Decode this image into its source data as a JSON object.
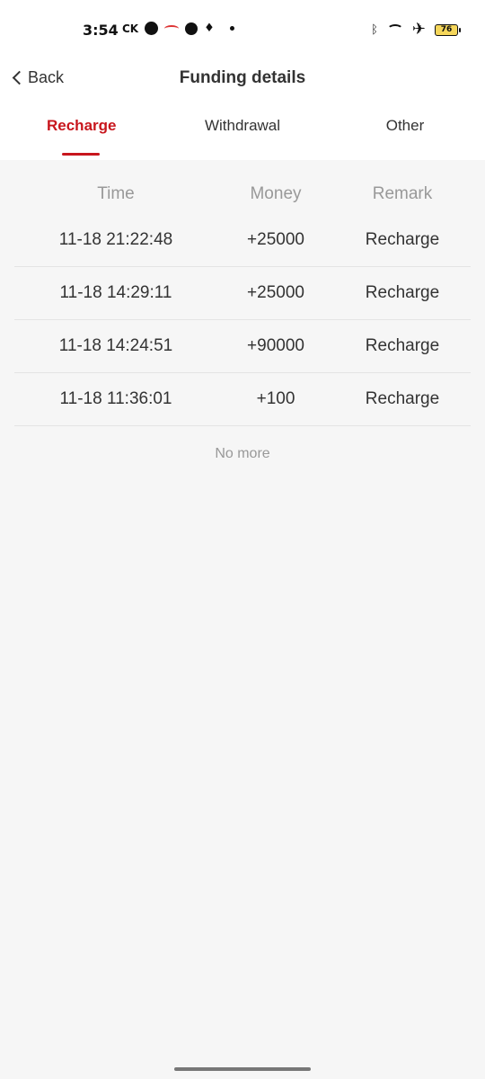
{
  "status": {
    "time": "3:54",
    "carrier_label": "CK",
    "battery": "76",
    "icons": [
      "call-icon",
      "notification-icon",
      "jio-icon",
      "bell-icon",
      "bluetooth-icon",
      "wifi-icon",
      "airplane-icon",
      "battery-icon"
    ]
  },
  "nav": {
    "back_label": "Back",
    "title": "Funding details"
  },
  "tabs": [
    {
      "label": "Recharge",
      "active": true
    },
    {
      "label": "Withdrawal",
      "active": false
    },
    {
      "label": "Other",
      "active": false
    }
  ],
  "table": {
    "headers": [
      "Time",
      "Money",
      "Remark"
    ],
    "rows": [
      {
        "time": "11-18 21:22:48",
        "money": "+25000",
        "remark": "Recharge"
      },
      {
        "time": "11-18 14:29:11",
        "money": "+25000",
        "remark": "Recharge"
      },
      {
        "time": "11-18 14:24:51",
        "money": "+90000",
        "remark": "Recharge"
      },
      {
        "time": "11-18 11:36:01",
        "money": "+100",
        "remark": "Recharge"
      }
    ]
  },
  "footer": {
    "no_more": "No more"
  },
  "colors": {
    "accent": "#c8161d",
    "background": "#f6f6f6",
    "text": "#333333",
    "muted": "#999999"
  }
}
